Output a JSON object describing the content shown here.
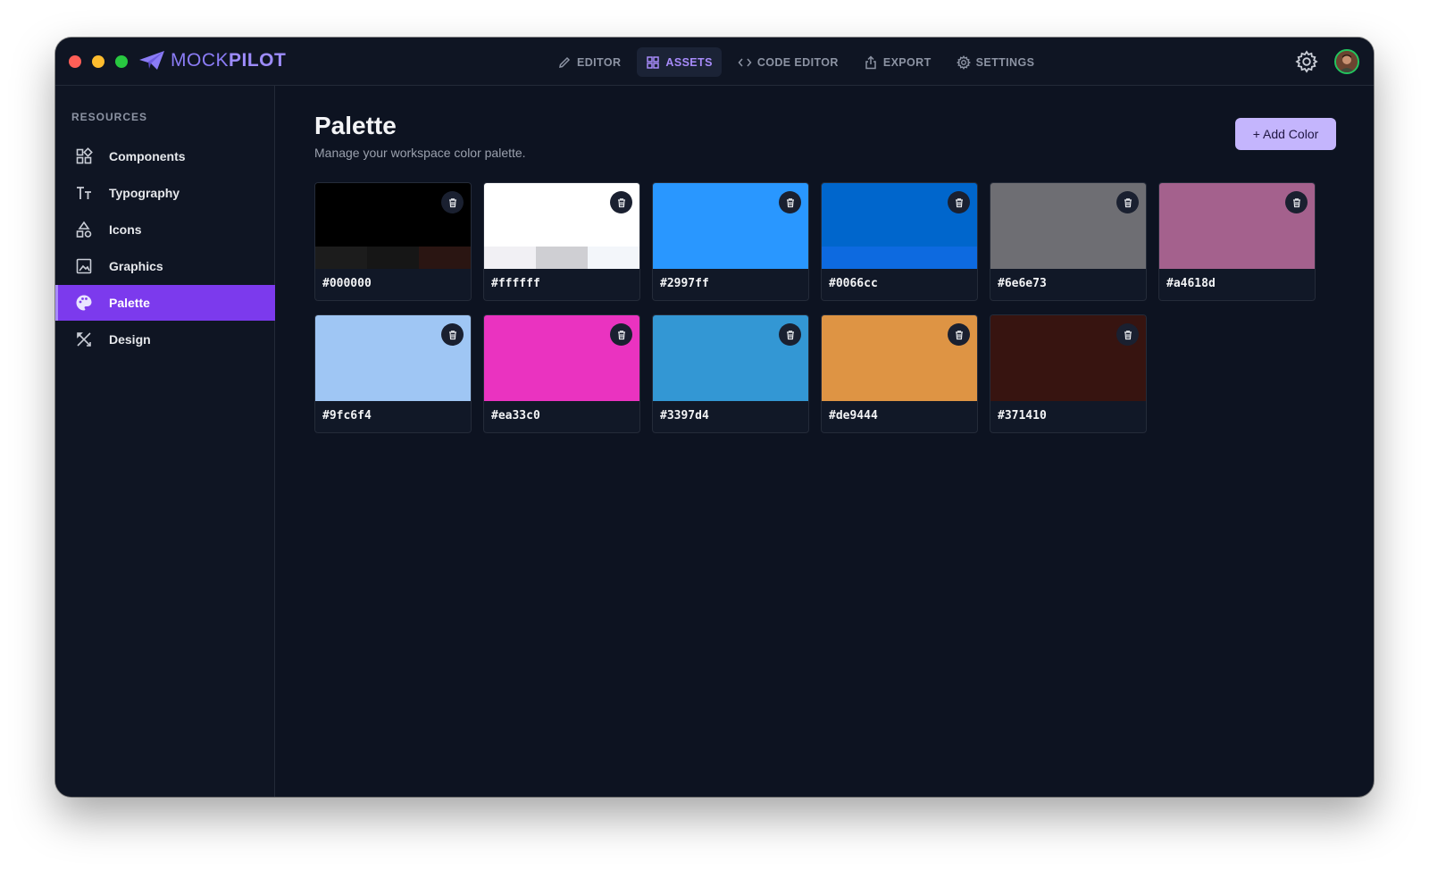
{
  "app": {
    "brand": "MOCKPILOT",
    "brand_thin": "MOCK",
    "brand_bold": "PILOT"
  },
  "nav": [
    {
      "label": "EDITOR",
      "icon": "pencil-icon",
      "active": false
    },
    {
      "label": "ASSETS",
      "icon": "grid-icon",
      "active": true
    },
    {
      "label": "CODE EDITOR",
      "icon": "code-icon",
      "active": false
    },
    {
      "label": "EXPORT",
      "icon": "share-icon",
      "active": false
    },
    {
      "label": "SETTINGS",
      "icon": "gear-icon",
      "active": false
    }
  ],
  "sidebar": {
    "heading": "RESOURCES",
    "items": [
      {
        "label": "Components",
        "icon": "components-icon",
        "active": false
      },
      {
        "label": "Typography",
        "icon": "typography-icon",
        "active": false
      },
      {
        "label": "Icons",
        "icon": "shapes-icon",
        "active": false
      },
      {
        "label": "Graphics",
        "icon": "image-icon",
        "active": false
      },
      {
        "label": "Palette",
        "icon": "palette-icon",
        "active": true
      },
      {
        "label": "Design",
        "icon": "design-tools-icon",
        "active": false
      }
    ]
  },
  "main": {
    "title": "Palette",
    "subtitle": "Manage your workspace color palette.",
    "add_button": "+ Add Color"
  },
  "colors": [
    {
      "hex": "#000000",
      "tints": [
        "#1c1c1c",
        "#161616",
        "#2a1512"
      ]
    },
    {
      "hex": "#ffffff",
      "tints": [
        "#f1f0f4",
        "#cfcfd3",
        "#f3f6fa"
      ]
    },
    {
      "hex": "#2997ff"
    },
    {
      "hex": "#0066cc",
      "tints": [
        "#0d6ae0"
      ]
    },
    {
      "hex": "#6e6e73"
    },
    {
      "hex": "#a4618d"
    },
    {
      "hex": "#9fc6f4"
    },
    {
      "hex": "#ea33c0"
    },
    {
      "hex": "#3397d4"
    },
    {
      "hex": "#de9444"
    },
    {
      "hex": "#371410"
    }
  ],
  "theme": {
    "accent": "#7c3aed",
    "accent_light": "#c4b5fd",
    "background": "#0d1321"
  }
}
